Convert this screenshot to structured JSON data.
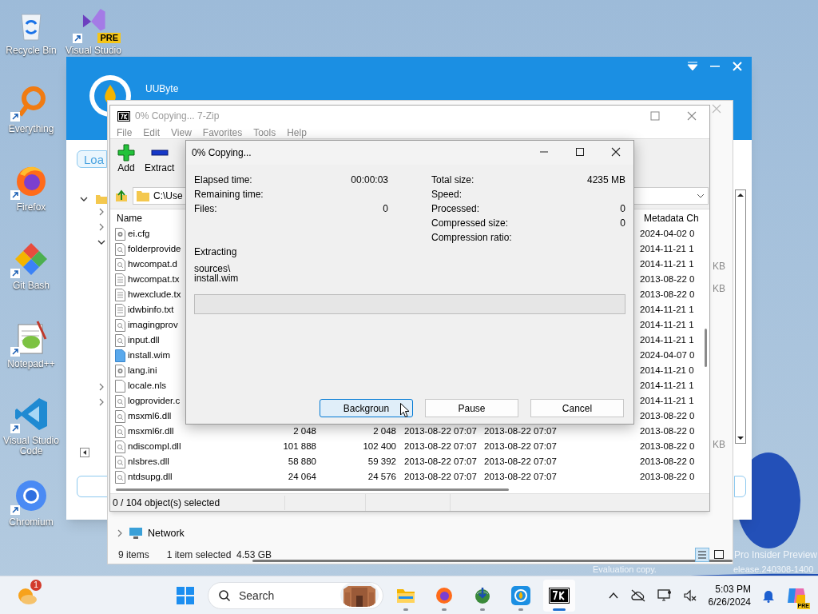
{
  "desktop": {
    "icons": [
      {
        "kind": "recycle-bin",
        "label": "Recycle Bin",
        "shortcut": false
      },
      {
        "kind": "visual-studio",
        "label": "Visual Studio",
        "badge": "PRE",
        "shortcut": true
      },
      {
        "kind": "everything",
        "label": "Everything",
        "shortcut": true
      },
      {
        "kind": "firefox",
        "label": "Firefox",
        "shortcut": true
      },
      {
        "kind": "git-bash",
        "label": "Git Bash",
        "shortcut": true
      },
      {
        "kind": "notepad",
        "label": "Notepad++",
        "shortcut": true
      },
      {
        "kind": "vscode",
        "label": "Visual Studio Code",
        "shortcut": true
      },
      {
        "kind": "chromium",
        "label": "Chromium",
        "shortcut": true
      }
    ],
    "notice": {
      "line_1": "Pro Insider Preview",
      "line_2a": "Evaluation copy.",
      "line_2b": "elease.240308-1400"
    }
  },
  "uubyte_window": {
    "title": "UUByte",
    "load_button": "Loa",
    "tree_toggles_top": [
      {
        "expanded": false
      },
      {
        "expanded": false
      },
      {
        "expanded": true
      }
    ],
    "tree_toggles_bottom": [
      {
        "expanded": false
      },
      {
        "expanded": false
      }
    ]
  },
  "explorer_window": {
    "size_units": [
      "KB",
      "KB",
      "KB"
    ],
    "nav_item": "Network",
    "status_items": "9 items",
    "status_selection": "1 item selected  4.53 GB"
  },
  "sevenzip_window": {
    "title": "0% Copying... 7-Zip",
    "menu": [
      "File",
      "Edit",
      "View",
      "Favorites",
      "Tools",
      "Help"
    ],
    "toolbar": [
      {
        "kind": "add",
        "label": "Add"
      },
      {
        "kind": "extract",
        "label": "Extract"
      }
    ],
    "path": "C:\\Use",
    "columns": {
      "name": "Name",
      "metadata": "Metadata Ch"
    },
    "rows": [
      {
        "kind": "settings",
        "name": "ei.cfg",
        "metadata": "2024-04-02 0"
      },
      {
        "kind": "library",
        "name": "folderprovide",
        "metadata": "2014-11-21 1"
      },
      {
        "kind": "library",
        "name": "hwcompat.d",
        "metadata": "2014-11-21 1"
      },
      {
        "kind": "text",
        "name": "hwcompat.tx",
        "metadata": "2013-08-22 0"
      },
      {
        "kind": "text",
        "name": "hwexclude.tx",
        "metadata": "2013-08-22 0"
      },
      {
        "kind": "text",
        "name": "idwbinfo.txt",
        "metadata": "2014-11-21 1"
      },
      {
        "kind": "library",
        "name": "imagingprov",
        "metadata": "2014-11-21 1"
      },
      {
        "kind": "library",
        "name": "input.dll",
        "metadata": "2014-11-21 1"
      },
      {
        "kind": "archive",
        "name": "install.wim",
        "metadata": "2024-04-07 0"
      },
      {
        "kind": "settings",
        "name": "lang.ini",
        "metadata": "2014-11-21 0"
      },
      {
        "kind": "blank",
        "name": "locale.nls",
        "metadata": "2014-11-21 1"
      },
      {
        "kind": "library",
        "name": "logprovider.c",
        "metadata": "2014-11-21 1"
      },
      {
        "kind": "library",
        "name": "msxml6.dll",
        "metadata": "2013-08-22 0"
      },
      {
        "kind": "library",
        "name": "msxml6r.dll",
        "size": "2 048",
        "packed": "2 048",
        "modified": "2013-08-22 07:07",
        "created": "2013-08-22 07:07",
        "metadata": "2013-08-22 0"
      },
      {
        "kind": "library",
        "name": "ndiscompl.dll",
        "size": "101 888",
        "packed": "102 400",
        "modified": "2013-08-22 07:07",
        "created": "2013-08-22 07:07",
        "metadata": "2013-08-22 0"
      },
      {
        "kind": "library",
        "name": "nlsbres.dll",
        "size": "58 880",
        "packed": "59 392",
        "modified": "2013-08-22 07:07",
        "created": "2013-08-22 07:07",
        "metadata": "2013-08-22 0"
      },
      {
        "kind": "library",
        "name": "ntdsupg.dll",
        "size": "24 064",
        "packed": "24 576",
        "modified": "2013-08-22 07:07",
        "created": "2013-08-22 07:07",
        "metadata": "2013-08-22 0"
      }
    ],
    "status": "0 / 104 object(s) selected"
  },
  "dialog": {
    "title": "0% Copying...",
    "left_stats": [
      {
        "label": "Elapsed time:",
        "value": "00:00:03"
      },
      {
        "label": "Remaining time:"
      },
      {
        "label": "Files:",
        "value": "0"
      }
    ],
    "right_stats": [
      {
        "label": "Total size:",
        "value": "4235 MB"
      },
      {
        "label": "Speed:"
      },
      {
        "label": "Processed:",
        "value": "0"
      },
      {
        "label": "Compressed size:",
        "value": "0"
      },
      {
        "label": "Compression ratio:"
      }
    ],
    "operation": "Extracting",
    "path_lines": [
      "sources\\",
      "install.wim"
    ],
    "progress": {
      "level": 0
    },
    "buttons": [
      {
        "label": "Backgroun",
        "focused": true
      },
      {
        "label": "Pause",
        "focused": false
      },
      {
        "label": "Cancel",
        "focused": false
      }
    ]
  },
  "taskbar": {
    "weather_badge": "1",
    "search": {
      "placeholder": "Search"
    },
    "apps": [
      {
        "kind": "folder",
        "running": true,
        "active": false
      },
      {
        "kind": "firefox",
        "running": true,
        "active": false
      },
      {
        "kind": "download-globe",
        "running": true,
        "active": false
      },
      {
        "kind": "uubyte",
        "running": true,
        "active": false
      },
      {
        "kind": "sevenzip",
        "running": true,
        "active": true
      }
    ],
    "clock_time": "5:03 PM",
    "clock_date": "6/26/2024",
    "copilot_badge": "PRE"
  }
}
